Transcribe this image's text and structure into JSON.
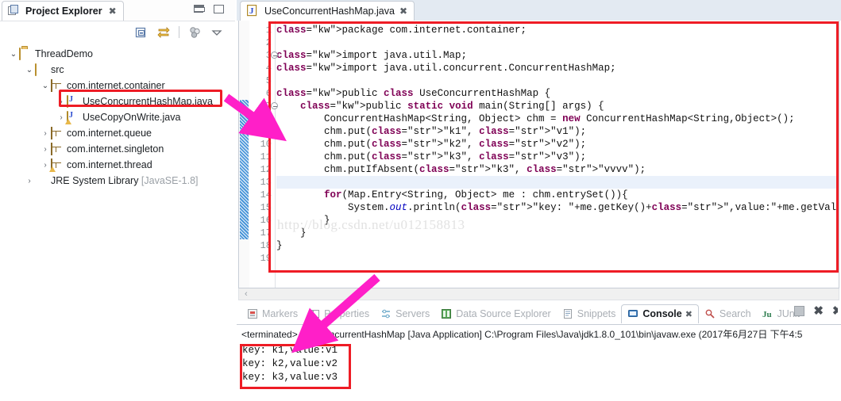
{
  "explorer": {
    "tab_label": "Project Explorer",
    "tab_close": "✖",
    "toolbar_icons": [
      "collapse-all-icon",
      "link-with-editor-icon",
      "view-menu-icon",
      "view-menu-arrow-icon"
    ],
    "window_buttons": [
      "minimize",
      "maximize"
    ],
    "tree": [
      {
        "label": "ThreadDemo",
        "suffix": "",
        "icon": "java-project-icon",
        "arrow": "⌄",
        "indent": 10,
        "expanded": true,
        "selected": false
      },
      {
        "label": "src",
        "suffix": "",
        "icon": "source-folder-icon",
        "arrow": "⌄",
        "indent": 30,
        "expanded": true,
        "selected": false
      },
      {
        "label": "com.internet.container",
        "suffix": "",
        "icon": "package-icon",
        "arrow": "⌄",
        "indent": 50,
        "expanded": true,
        "selected": false
      },
      {
        "label": "UseConcurrentHashMap.java",
        "suffix": "",
        "icon": "java-file-icon",
        "arrow": "›",
        "indent": 70,
        "expanded": false,
        "selected": true
      },
      {
        "label": "UseCopyOnWrite.java",
        "suffix": "",
        "icon": "java-file-warn-icon",
        "arrow": "›",
        "indent": 70,
        "expanded": false,
        "selected": false
      },
      {
        "label": "com.internet.queue",
        "suffix": "",
        "icon": "package-icon",
        "arrow": "›",
        "indent": 50,
        "expanded": false,
        "selected": false
      },
      {
        "label": "com.internet.singleton",
        "suffix": "",
        "icon": "package-icon",
        "arrow": "›",
        "indent": 50,
        "expanded": false,
        "selected": false
      },
      {
        "label": "com.internet.thread",
        "suffix": "",
        "icon": "package-warn-icon",
        "arrow": "›",
        "indent": 50,
        "expanded": false,
        "selected": false
      },
      {
        "label": "JRE System Library",
        "suffix": " [JavaSE-1.8]",
        "icon": "jre-library-icon",
        "arrow": "›",
        "indent": 30,
        "expanded": false,
        "selected": false
      }
    ]
  },
  "editor": {
    "tab_label": "UseConcurrentHashMap.java",
    "tab_icon": "java-file-icon",
    "tab_close": "✖",
    "current_line": 13,
    "change_bar_from_line": 7,
    "change_bar_to_line": 17,
    "fold_lines": [
      3,
      7
    ],
    "watermark": "http://blog.csdn.net/u012158813",
    "lines": [
      {
        "n": 1,
        "text": "package com.internet.container;"
      },
      {
        "n": 2,
        "text": ""
      },
      {
        "n": 3,
        "text": "import java.util.Map;"
      },
      {
        "n": 4,
        "text": "import java.util.concurrent.ConcurrentHashMap;"
      },
      {
        "n": 5,
        "text": ""
      },
      {
        "n": 6,
        "text": "public class UseConcurrentHashMap {"
      },
      {
        "n": 7,
        "text": "    public static void main(String[] args) {"
      },
      {
        "n": 8,
        "text": "        ConcurrentHashMap<String, Object> chm = new ConcurrentHashMap<String,Object>();"
      },
      {
        "n": 9,
        "text": "        chm.put(\"k1\", \"v1\");"
      },
      {
        "n": 10,
        "text": "        chm.put(\"k2\", \"v2\");"
      },
      {
        "n": 11,
        "text": "        chm.put(\"k3\", \"v3\");"
      },
      {
        "n": 12,
        "text": "        chm.putIfAbsent(\"k3\", \"vvvv\");"
      },
      {
        "n": 13,
        "text": ""
      },
      {
        "n": 14,
        "text": "        for(Map.Entry<String, Object> me : chm.entrySet()){"
      },
      {
        "n": 15,
        "text": "            System.out.println(\"key: \"+me.getKey()+\",value:\"+me.getValue());"
      },
      {
        "n": 16,
        "text": "        }"
      },
      {
        "n": 17,
        "text": "    }"
      },
      {
        "n": 18,
        "text": "}"
      },
      {
        "n": 19,
        "text": ""
      }
    ],
    "hscroll_left_chevron": "‹"
  },
  "console": {
    "tabs": [
      {
        "label": "Markers",
        "icon": "markers-icon",
        "active": false
      },
      {
        "label": "Properties",
        "icon": "properties-icon",
        "active": false
      },
      {
        "label": "Servers",
        "icon": "servers-icon",
        "active": false
      },
      {
        "label": "Data Source Explorer",
        "icon": "datasource-icon",
        "active": false
      },
      {
        "label": "Snippets",
        "icon": "snippets-icon",
        "active": false
      },
      {
        "label": "Console",
        "icon": "console-icon",
        "active": true,
        "close": "✖"
      },
      {
        "label": "Search",
        "icon": "search-icon",
        "active": false
      },
      {
        "label": "JUnit",
        "icon": "junit-icon",
        "active": false
      }
    ],
    "tools": [
      "terminate-icon",
      "remove-launch-icon",
      "remove-all-launches-icon"
    ],
    "status_line": "<terminated> UseConcurrentHashMap [Java Application] C:\\Program Files\\Java\\jdk1.8.0_101\\bin\\javaw.exe (2017年6月27日 下午4:5",
    "output": [
      "key: k1,value:v1",
      "key: k2,value:v2",
      "key: k3,value:v3"
    ]
  },
  "annotations": {
    "highlight_color": "#ee1c25",
    "arrow_color": "#ff1fc8",
    "boxes": [
      "tree-file-highlight",
      "code-highlight",
      "console-output-highlight"
    ],
    "arrows": [
      "tree-file-to-code-arrow",
      "code-to-console-arrow"
    ]
  }
}
